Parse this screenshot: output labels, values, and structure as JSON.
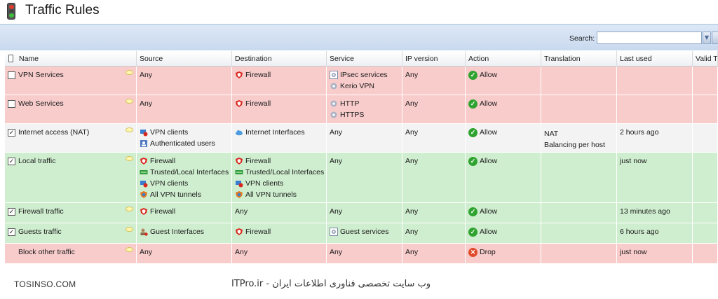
{
  "app": {
    "title": "Traffic Rules"
  },
  "search": {
    "label": "Search:",
    "value": ""
  },
  "columns": [
    "Name",
    "Source",
    "Destination",
    "Service",
    "IP version",
    "Action",
    "Translation",
    "Last used",
    "Valid Ti"
  ],
  "colors": {
    "deny_row": "#f9cccc",
    "allow_row": "#cfeecf",
    "neutral_row": "#f3f3f3"
  },
  "rules": [
    {
      "name": "VPN Services",
      "checked": false,
      "color": "red",
      "source": [
        {
          "text": "Any",
          "icon": ""
        }
      ],
      "destination": [
        {
          "text": "Firewall",
          "icon": "firewall-icon"
        }
      ],
      "service": [
        {
          "text": "IPsec services",
          "icon": "service-group-icon"
        },
        {
          "text": "Kerio VPN",
          "icon": "service-icon"
        }
      ],
      "ip_version": "Any",
      "action": "Allow",
      "action_icon": "allow-icon",
      "translation": [],
      "last_used": ""
    },
    {
      "name": "Web Services",
      "checked": false,
      "color": "red",
      "source": [
        {
          "text": "Any",
          "icon": ""
        }
      ],
      "destination": [
        {
          "text": "Firewall",
          "icon": "firewall-icon"
        }
      ],
      "service": [
        {
          "text": "HTTP",
          "icon": "service-icon"
        },
        {
          "text": "HTTPS",
          "icon": "service-icon"
        }
      ],
      "ip_version": "Any",
      "action": "Allow",
      "action_icon": "allow-icon",
      "translation": [],
      "last_used": ""
    },
    {
      "name": "Internet access (NAT)",
      "checked": true,
      "color": "white",
      "source": [
        {
          "text": "VPN clients",
          "icon": "vpn-clients-icon"
        },
        {
          "text": "Authenticated users",
          "icon": "users-icon"
        }
      ],
      "destination": [
        {
          "text": "Internet Interfaces",
          "icon": "cloud-icon"
        }
      ],
      "service": [
        {
          "text": "Any",
          "icon": ""
        }
      ],
      "ip_version": "Any",
      "action": "Allow",
      "action_icon": "allow-icon",
      "translation": [
        "NAT",
        "Balancing per host"
      ],
      "last_used": "2 hours ago"
    },
    {
      "name": "Local traffic",
      "checked": true,
      "color": "green",
      "source": [
        {
          "text": "Firewall",
          "icon": "firewall-icon"
        },
        {
          "text": "Trusted/Local Interfaces",
          "icon": "interfaces-icon"
        },
        {
          "text": "VPN clients",
          "icon": "vpn-clients-icon"
        },
        {
          "text": "All VPN tunnels",
          "icon": "vpn-tunnel-icon"
        }
      ],
      "destination": [
        {
          "text": "Firewall",
          "icon": "firewall-icon"
        },
        {
          "text": "Trusted/Local Interfaces",
          "icon": "interfaces-icon"
        },
        {
          "text": "VPN clients",
          "icon": "vpn-clients-icon"
        },
        {
          "text": "All VPN tunnels",
          "icon": "vpn-tunnel-icon"
        }
      ],
      "service": [
        {
          "text": "Any",
          "icon": ""
        }
      ],
      "ip_version": "Any",
      "action": "Allow",
      "action_icon": "allow-icon",
      "translation": [],
      "last_used": "just now"
    },
    {
      "name": "Firewall traffic",
      "checked": true,
      "color": "green",
      "source": [
        {
          "text": "Firewall",
          "icon": "firewall-icon"
        }
      ],
      "destination": [
        {
          "text": "Any",
          "icon": ""
        }
      ],
      "service": [
        {
          "text": "Any",
          "icon": ""
        }
      ],
      "ip_version": "Any",
      "action": "Allow",
      "action_icon": "allow-icon",
      "translation": [],
      "last_used": "13 minutes ago"
    },
    {
      "name": "Guests traffic",
      "checked": true,
      "color": "green",
      "source": [
        {
          "text": "Guest Interfaces",
          "icon": "guest-icon"
        }
      ],
      "destination": [
        {
          "text": "Firewall",
          "icon": "firewall-icon"
        }
      ],
      "service": [
        {
          "text": "Guest services",
          "icon": "service-group-icon"
        }
      ],
      "ip_version": "Any",
      "action": "Allow",
      "action_icon": "allow-icon",
      "translation": [],
      "last_used": "6 hours ago"
    },
    {
      "name": "Block other traffic",
      "checked": null,
      "color": "red",
      "source": [
        {
          "text": "Any",
          "icon": ""
        }
      ],
      "destination": [
        {
          "text": "Any",
          "icon": ""
        }
      ],
      "service": [
        {
          "text": "Any",
          "icon": ""
        }
      ],
      "ip_version": "Any",
      "action": "Drop",
      "action_icon": "drop-icon",
      "translation": [],
      "last_used": "just now"
    }
  ],
  "footer": {
    "left": "TOSINSO.COM",
    "right": "ITPro.ir - وب سایت تخصصی فناوری اطلاعات ایران"
  }
}
